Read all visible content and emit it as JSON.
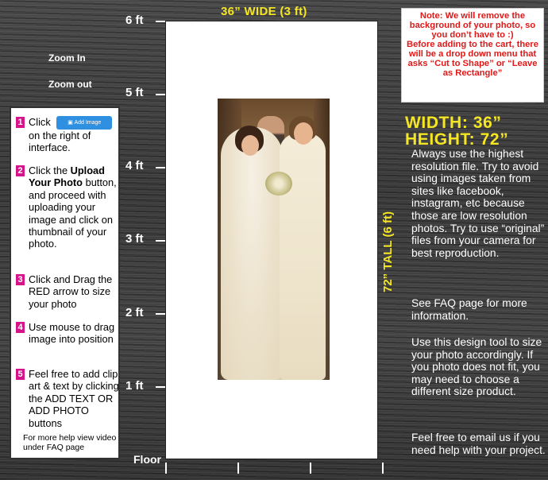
{
  "ruler": {
    "labels": [
      "6 ft",
      "5 ft",
      "4 ft",
      "3 ft",
      "2 ft",
      "1 ft"
    ],
    "floor": "Floor"
  },
  "zoom": {
    "in": "Zoom In",
    "out": "Zoom out"
  },
  "canvas_title": "36” WIDE (3 ft)",
  "vertical_label": "72” TALL (6 ft)",
  "note": {
    "line1": "Note: We will remove the background of your photo, so you don’t have to :)",
    "line2": "Before adding to the cart, there will be a drop down menu that asks “Cut to Shape” or “Leave as Rectangle”"
  },
  "dimensions": {
    "width": "WIDTH: 36”",
    "height": "HEIGHT: 72”"
  },
  "instructions": {
    "step1": {
      "num": "1",
      "text_a": "Click",
      "button": "Add Image",
      "text_b": "on the right of interface."
    },
    "step2": {
      "num": "2",
      "text_a": "Click the ",
      "bold": "Upload Your Photo",
      "text_b": " button, and proceed with uploading your image and click on thumbnail of your photo."
    },
    "step3": {
      "num": "3",
      "text": "Click and Drag the RED arrow to size your photo"
    },
    "step4": {
      "num": "4",
      "text": "Use mouse to drag image into position"
    },
    "step5": {
      "num": "5",
      "text": "Feel free to add clip art & text by clicking the ADD TEXT OR ADD PHOTO buttons"
    },
    "help": "For more help view video under FAQ page"
  },
  "right_text": {
    "p1": "Always use the highest resolution file. Try to avoid using images taken from sites like facebook, instagram, etc because those are low resolution photos. Try to use “original” files from your camera for best reproduction.",
    "p2": "See FAQ page for more information.",
    "p3": "Use this design tool to size your photo accordingly.  If you photo does not fit, you may need to choose a different size product.",
    "p4": "Feel free to email us if you need help with your project."
  },
  "colors": {
    "accent_yellow": "#f5e625",
    "note_red": "#e01818",
    "step_magenta": "#d6148a",
    "button_blue": "#2f8fe0"
  }
}
